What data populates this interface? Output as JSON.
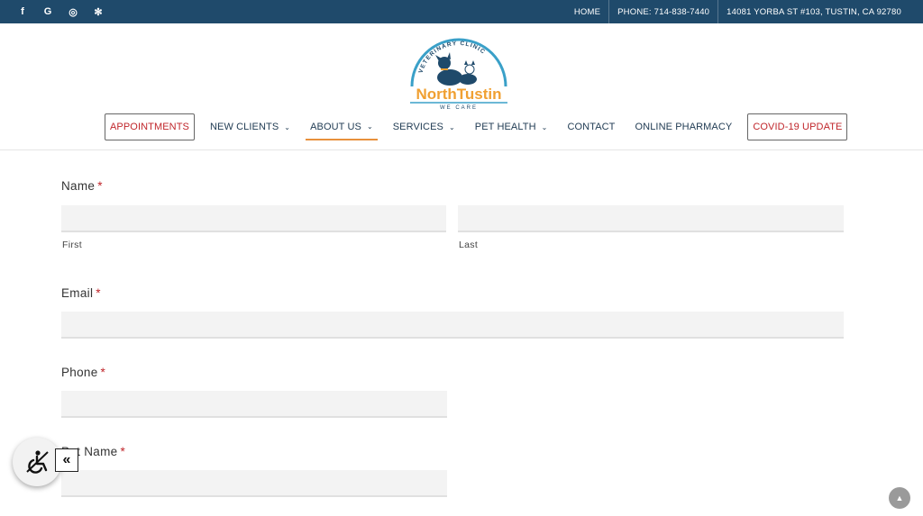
{
  "topbar": {
    "social": [
      {
        "icon": "facebook-icon",
        "glyph": "f"
      },
      {
        "icon": "google-icon",
        "glyph": "G"
      },
      {
        "icon": "instagram-icon",
        "glyph": "◎"
      },
      {
        "icon": "yelp-icon",
        "glyph": "✻"
      }
    ],
    "home": "HOME",
    "phone": "PHONE: 714-838-7440",
    "address": "14081 YORBA ST #103, TUSTIN, CA 92780"
  },
  "logo": {
    "arc_text": "VETERINARY CLINIC",
    "name": "NorthTustin",
    "tagline": "WE CARE",
    "colors": {
      "blue": "#1f4a6b",
      "orange": "#f0a032",
      "teal": "#3aa0c8"
    }
  },
  "nav": {
    "appointments": "APPOINTMENTS",
    "new_clients": "NEW CLIENTS",
    "about_us": "ABOUT US",
    "services": "SERVICES",
    "pet_health": "PET HEALTH",
    "contact": "CONTACT",
    "online_pharmacy": "ONLINE PHARMACY",
    "covid": "COVID-19 UPDATE",
    "chevron": "⌄"
  },
  "form": {
    "name_label": "Name",
    "required_mark": "*",
    "first_label": "First",
    "last_label": "Last",
    "email_label": "Email",
    "phone_label": "Phone",
    "pet_name_label": "Pet Name"
  },
  "a11y": {
    "toggle_glyph": "«"
  },
  "scrolltop": {
    "glyph": "▲"
  },
  "colors": {
    "topbar": "#1f4a6b",
    "required": "#c0262b",
    "active_underline": "#e8903c"
  }
}
